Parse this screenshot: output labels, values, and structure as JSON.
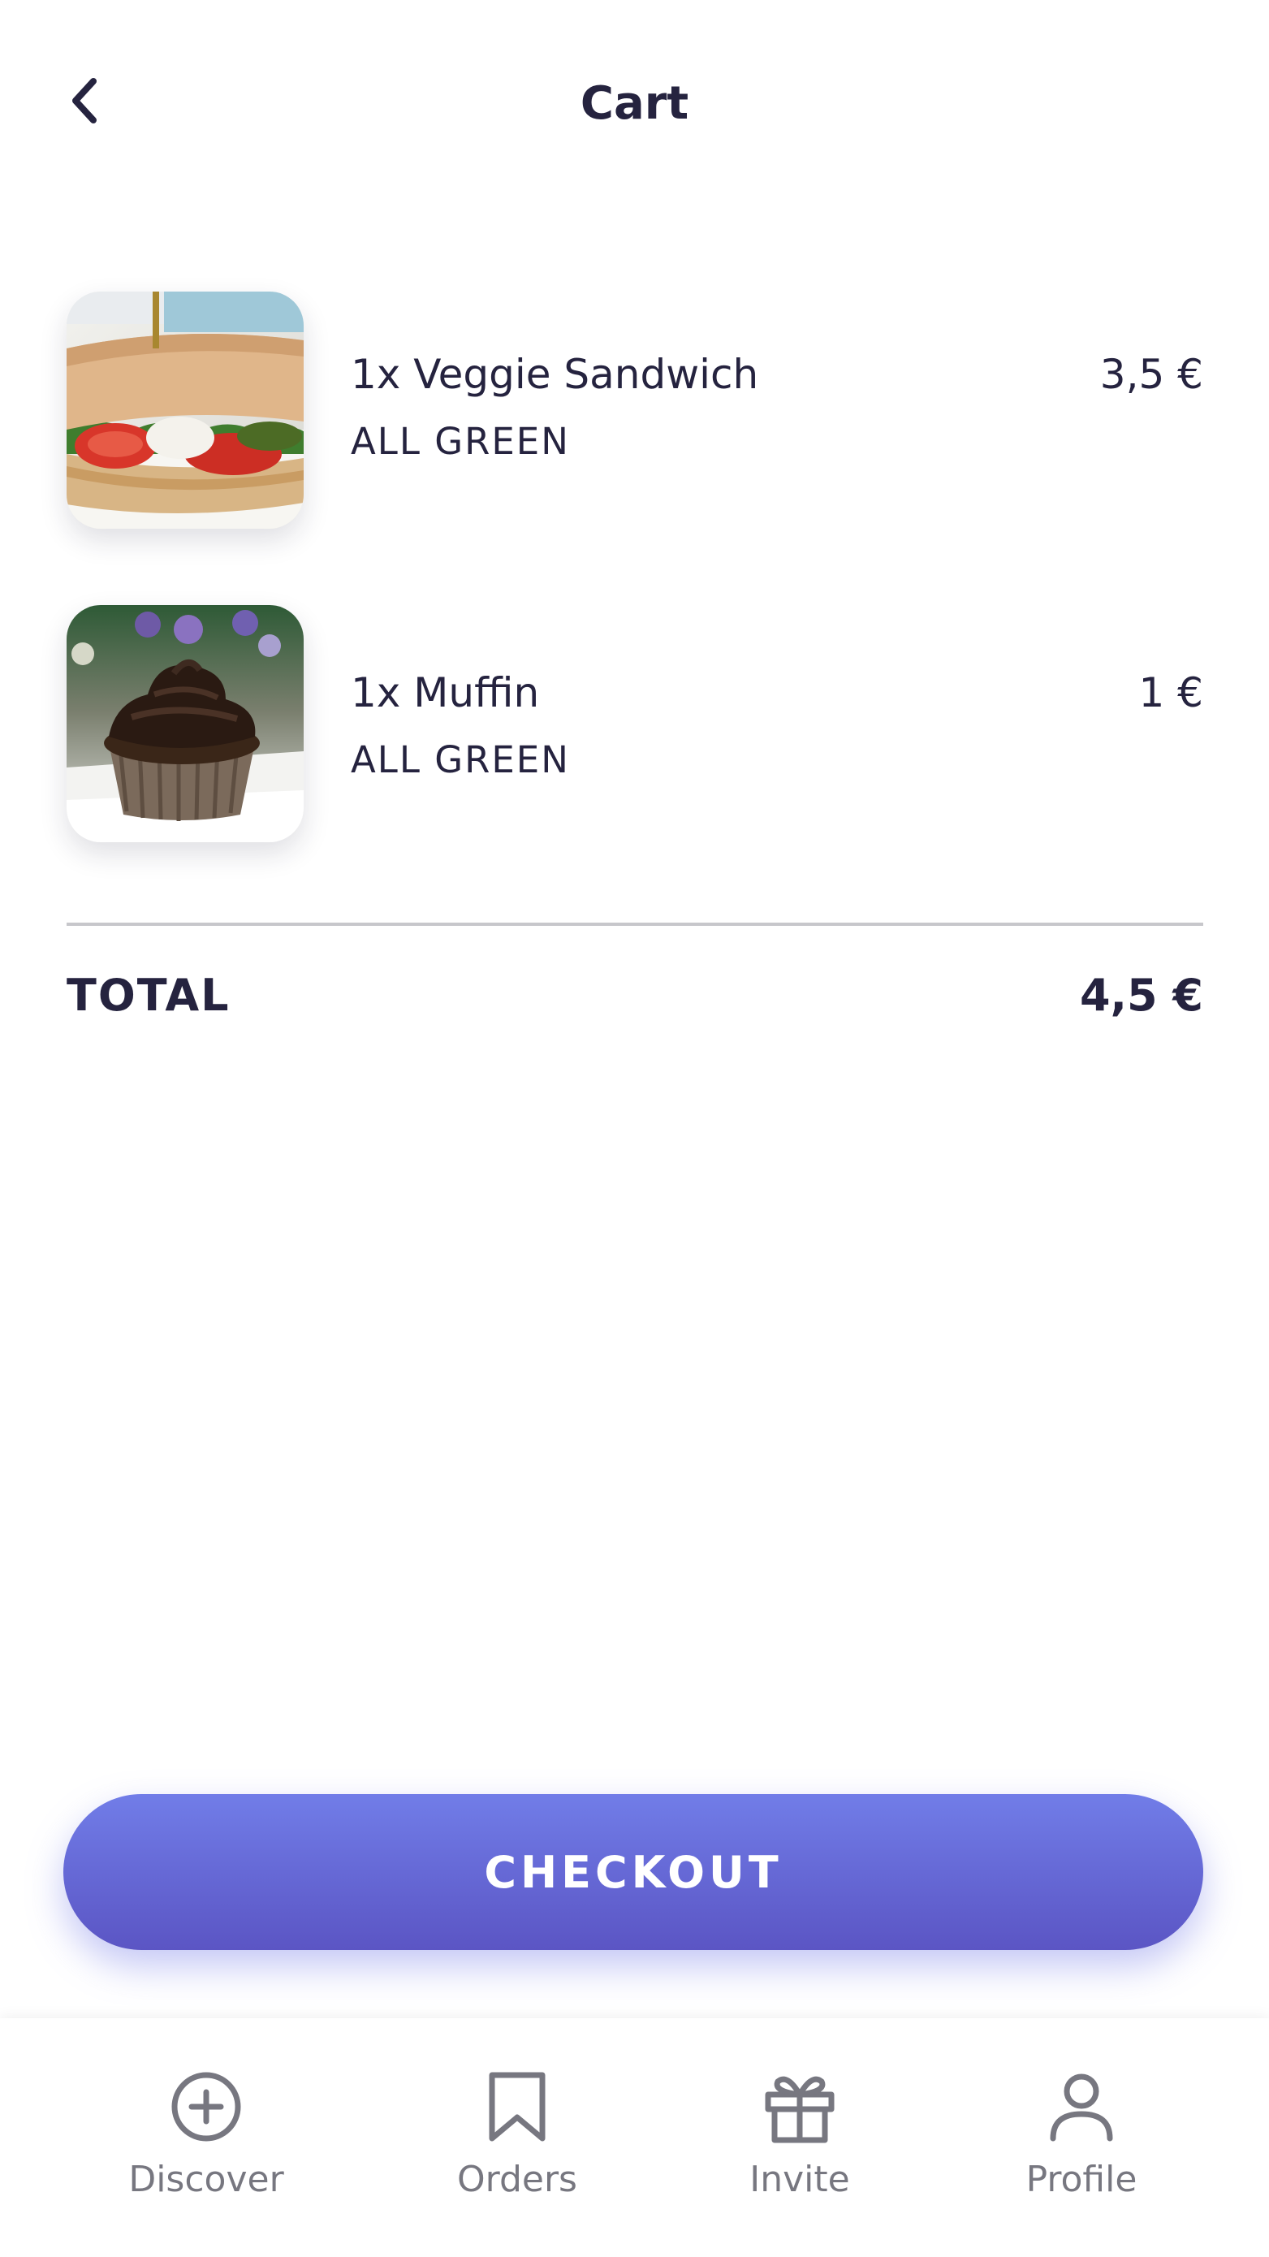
{
  "header": {
    "title": "Cart",
    "back_icon": "chevron-left-icon"
  },
  "cart": {
    "items": [
      {
        "name": "1x Veggie Sandwich",
        "vendor": "ALL GREEN",
        "price": "3,5 €",
        "image": "veggie-sandwich-photo"
      },
      {
        "name": "1x Muffin",
        "vendor": "ALL GREEN",
        "price": "1 €",
        "image": "chocolate-muffin-photo"
      }
    ],
    "total_label": "TOTAL",
    "total_value": "4,5 €"
  },
  "checkout": {
    "label": "CHECKOUT"
  },
  "tabbar": {
    "items": [
      {
        "label": "Discover",
        "icon": "plus-circle-icon"
      },
      {
        "label": "Orders",
        "icon": "bookmark-icon"
      },
      {
        "label": "Invite",
        "icon": "gift-icon"
      },
      {
        "label": "Profile",
        "icon": "user-icon"
      }
    ]
  },
  "colors": {
    "text": "#25233f",
    "accent_top": "#717de8",
    "accent_bottom": "#5b55c4",
    "tab_inactive": "#777780",
    "divider": "#c7c7cb"
  }
}
